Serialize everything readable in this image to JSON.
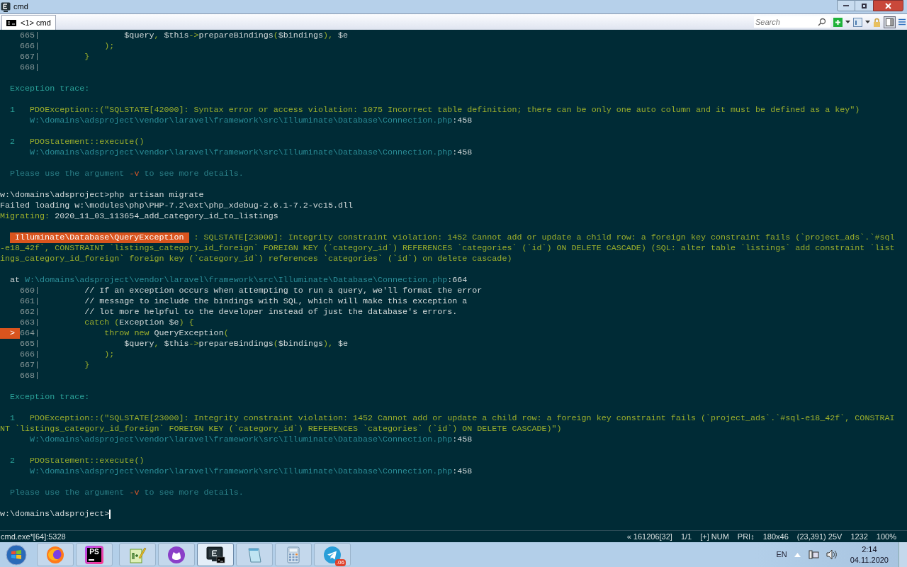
{
  "window": {
    "title": "cmd"
  },
  "tabs": [
    {
      "label": "<1> cmd",
      "selected": true
    }
  ],
  "toolbar": {
    "search": {
      "placeholder": "Search"
    }
  },
  "terminal": {
    "lines": [
      {
        "kind": "text",
        "segments": [
          {
            "kind": "lineno",
            "text": "    665|"
          },
          {
            "kind": "plain",
            "text": "                 $query"
          },
          {
            "kind": "green",
            "text": ","
          },
          {
            "kind": "plain",
            "text": " $this"
          },
          {
            "kind": "green",
            "text": "->"
          },
          {
            "kind": "plain",
            "text": "prepareBindings"
          },
          {
            "kind": "green",
            "text": "("
          },
          {
            "kind": "plain",
            "text": "$bindings"
          },
          {
            "kind": "green",
            "text": "),"
          },
          {
            "kind": "plain",
            "text": " $e"
          }
        ]
      },
      {
        "kind": "text",
        "segments": [
          {
            "kind": "lineno",
            "text": "    666|"
          },
          {
            "kind": "green",
            "text": "             );"
          }
        ]
      },
      {
        "kind": "text",
        "segments": [
          {
            "kind": "lineno",
            "text": "    667|"
          },
          {
            "kind": "green",
            "text": "         }"
          }
        ]
      },
      {
        "kind": "text",
        "segments": [
          {
            "kind": "lineno",
            "text": "    668|"
          }
        ]
      },
      {
        "kind": "blank"
      },
      {
        "kind": "text",
        "segments": [
          {
            "kind": "heading",
            "text": "  Exception trace:"
          }
        ]
      },
      {
        "kind": "blank"
      },
      {
        "kind": "text",
        "segments": [
          {
            "kind": "num",
            "text": "  1"
          },
          {
            "kind": "green",
            "text": "   PDOException::(\"SQLSTATE[42000]: Syntax error or access violation: 1075 Incorrect table definition; there can be only one auto column and it must be defined as a key\")"
          }
        ]
      },
      {
        "kind": "text",
        "segments": [
          {
            "kind": "path",
            "text": "      W:\\domains\\adsproject\\vendor\\laravel\\framework\\src\\Illuminate\\Database\\Connection.php"
          },
          {
            "kind": "plain",
            "text": ":458"
          }
        ]
      },
      {
        "kind": "blank"
      },
      {
        "kind": "text",
        "segments": [
          {
            "kind": "num",
            "text": "  2"
          },
          {
            "kind": "green",
            "text": "   PDOStatement::execute()"
          }
        ]
      },
      {
        "kind": "text",
        "segments": [
          {
            "kind": "path",
            "text": "      W:\\domains\\adsproject\\vendor\\laravel\\framework\\src\\Illuminate\\Database\\Connection.php"
          },
          {
            "kind": "plain",
            "text": ":458"
          }
        ]
      },
      {
        "kind": "blank"
      },
      {
        "kind": "text",
        "segments": [
          {
            "kind": "hint",
            "text": "  Please use the argument"
          },
          {
            "kind": "flag",
            "text": " -v"
          },
          {
            "kind": "hint",
            "text": " to see more details."
          }
        ]
      },
      {
        "kind": "blank"
      },
      {
        "kind": "text",
        "segments": [
          {
            "kind": "plain",
            "text": "w:\\domains\\adsproject>php artisan migrate"
          }
        ]
      },
      {
        "kind": "text",
        "segments": [
          {
            "kind": "plain",
            "text": "Failed loading w:\\modules\\php\\PHP-7.2\\ext\\php_xdebug-2.6.1-7.2-vc15.dll"
          }
        ]
      },
      {
        "kind": "text",
        "segments": [
          {
            "kind": "green",
            "text": "Migrating:"
          },
          {
            "kind": "plain",
            "text": " 2020_11_03_113654_add_category_id_to_listings"
          }
        ]
      },
      {
        "kind": "blank"
      },
      {
        "kind": "text",
        "segments": [
          {
            "kind": "badge",
            "text": " Illuminate\\Database\\QueryException "
          },
          {
            "kind": "green",
            "text": " : SQLSTATE[23000]: Integrity constraint violation: 1452 Cannot add or update a child row: a foreign key constraint fails (`project_ads`.`#sql"
          }
        ]
      },
      {
        "kind": "text",
        "segments": [
          {
            "kind": "green",
            "text": "-e18_42f`, CONSTRAINT `listings_category_id_foreign` FOREIGN KEY (`category_id`) REFERENCES `categories` (`id`) ON DELETE CASCADE) (SQL: alter table `listings` add constraint `list"
          }
        ]
      },
      {
        "kind": "text",
        "segments": [
          {
            "kind": "green",
            "text": "ings_category_id_foreign` foreign key (`category_id`) references `categories` (`id`) on delete cascade)"
          }
        ]
      },
      {
        "kind": "blank"
      },
      {
        "kind": "text",
        "segments": [
          {
            "kind": "plain",
            "text": "  at"
          },
          {
            "kind": "path",
            "text": " W:\\domains\\adsproject\\vendor\\laravel\\framework\\src\\Illuminate\\Database\\Connection.php"
          },
          {
            "kind": "plain",
            "text": ":664"
          }
        ]
      },
      {
        "kind": "text",
        "segments": [
          {
            "kind": "lineno",
            "text": "    660|"
          },
          {
            "kind": "plain",
            "text": "         // If an exception occurs when attempting to run a query, we'll format the error"
          }
        ]
      },
      {
        "kind": "text",
        "segments": [
          {
            "kind": "lineno",
            "text": "    661|"
          },
          {
            "kind": "plain",
            "text": "         // message to include the bindings with SQL, which will make this exception a"
          }
        ]
      },
      {
        "kind": "text",
        "segments": [
          {
            "kind": "lineno",
            "text": "    662|"
          },
          {
            "kind": "plain",
            "text": "         // lot more helpful to the developer instead of just the database's errors."
          }
        ]
      },
      {
        "kind": "text",
        "segments": [
          {
            "kind": "lineno",
            "text": "    663|"
          },
          {
            "kind": "green",
            "text": "         catch"
          },
          {
            "kind": "green",
            "text": " ("
          },
          {
            "kind": "plain",
            "text": "Exception $e"
          },
          {
            "kind": "green",
            "text": ") {"
          }
        ]
      },
      {
        "kind": "text",
        "segments": [
          {
            "kind": "marker",
            "text": "  > "
          },
          {
            "kind": "lineno",
            "text": "664|"
          },
          {
            "kind": "green",
            "text": "             throw new"
          },
          {
            "kind": "plain",
            "text": " QueryException"
          },
          {
            "kind": "green",
            "text": "("
          }
        ]
      },
      {
        "kind": "text",
        "segments": [
          {
            "kind": "lineno",
            "text": "    665|"
          },
          {
            "kind": "plain",
            "text": "                 $query"
          },
          {
            "kind": "green",
            "text": ","
          },
          {
            "kind": "plain",
            "text": " $this"
          },
          {
            "kind": "green",
            "text": "->"
          },
          {
            "kind": "plain",
            "text": "prepareBindings"
          },
          {
            "kind": "green",
            "text": "("
          },
          {
            "kind": "plain",
            "text": "$bindings"
          },
          {
            "kind": "green",
            "text": "),"
          },
          {
            "kind": "plain",
            "text": " $e"
          }
        ]
      },
      {
        "kind": "text",
        "segments": [
          {
            "kind": "lineno",
            "text": "    666|"
          },
          {
            "kind": "green",
            "text": "             );"
          }
        ]
      },
      {
        "kind": "text",
        "segments": [
          {
            "kind": "lineno",
            "text": "    667|"
          },
          {
            "kind": "green",
            "text": "         }"
          }
        ]
      },
      {
        "kind": "text",
        "segments": [
          {
            "kind": "lineno",
            "text": "    668|"
          }
        ]
      },
      {
        "kind": "blank"
      },
      {
        "kind": "text",
        "segments": [
          {
            "kind": "heading",
            "text": "  Exception trace:"
          }
        ]
      },
      {
        "kind": "blank"
      },
      {
        "kind": "text",
        "segments": [
          {
            "kind": "num",
            "text": "  1"
          },
          {
            "kind": "green",
            "text": "   PDOException::(\"SQLSTATE[23000]: Integrity constraint violation: 1452 Cannot add or update a child row: a foreign key constraint fails (`project_ads`.`#sql-e18_42f`, CONSTRAI"
          }
        ]
      },
      {
        "kind": "text",
        "segments": [
          {
            "kind": "green",
            "text": "NT `listings_category_id_foreign` FOREIGN KEY (`category_id`) REFERENCES `categories` (`id`) ON DELETE CASCADE)\")"
          }
        ]
      },
      {
        "kind": "text",
        "segments": [
          {
            "kind": "path",
            "text": "      W:\\domains\\adsproject\\vendor\\laravel\\framework\\src\\Illuminate\\Database\\Connection.php"
          },
          {
            "kind": "plain",
            "text": ":458"
          }
        ]
      },
      {
        "kind": "blank"
      },
      {
        "kind": "text",
        "segments": [
          {
            "kind": "num",
            "text": "  2"
          },
          {
            "kind": "green",
            "text": "   PDOStatement::execute()"
          }
        ]
      },
      {
        "kind": "text",
        "segments": [
          {
            "kind": "path",
            "text": "      W:\\domains\\adsproject\\vendor\\laravel\\framework\\src\\Illuminate\\Database\\Connection.php"
          },
          {
            "kind": "plain",
            "text": ":458"
          }
        ]
      },
      {
        "kind": "blank"
      },
      {
        "kind": "text",
        "segments": [
          {
            "kind": "hint",
            "text": "  Please use the argument"
          },
          {
            "kind": "flag",
            "text": " -v"
          },
          {
            "kind": "hint",
            "text": " to see more details."
          }
        ]
      },
      {
        "kind": "blank"
      },
      {
        "kind": "prompt",
        "segments": [
          {
            "kind": "plain",
            "text": "w:\\domains\\adsproject>"
          }
        ]
      }
    ]
  },
  "status_bar": {
    "process": "cmd.exe*[64]:5328",
    "fields": [
      "« 161206[32]",
      "1/1",
      "[+] NUM",
      "PRI↕",
      "180x46",
      "(23,391) 25V",
      "1232",
      "100%"
    ]
  },
  "taskbar": {
    "apps": [
      {
        "kind": "firefox",
        "selected": false
      },
      {
        "kind": "phpstorm",
        "label": "PS",
        "selected": false
      },
      {
        "kind": "notepadpp",
        "selected": false
      },
      {
        "kind": "cat",
        "selected": false
      },
      {
        "kind": "conemu",
        "selected": true
      },
      {
        "kind": "notepad",
        "selected": false
      },
      {
        "kind": "calculator",
        "selected": false
      },
      {
        "kind": "telegram",
        "badge": ".06",
        "selected": false
      }
    ],
    "tray": {
      "language": "EN",
      "time": "2:14",
      "date": "04.11.2020"
    }
  }
}
